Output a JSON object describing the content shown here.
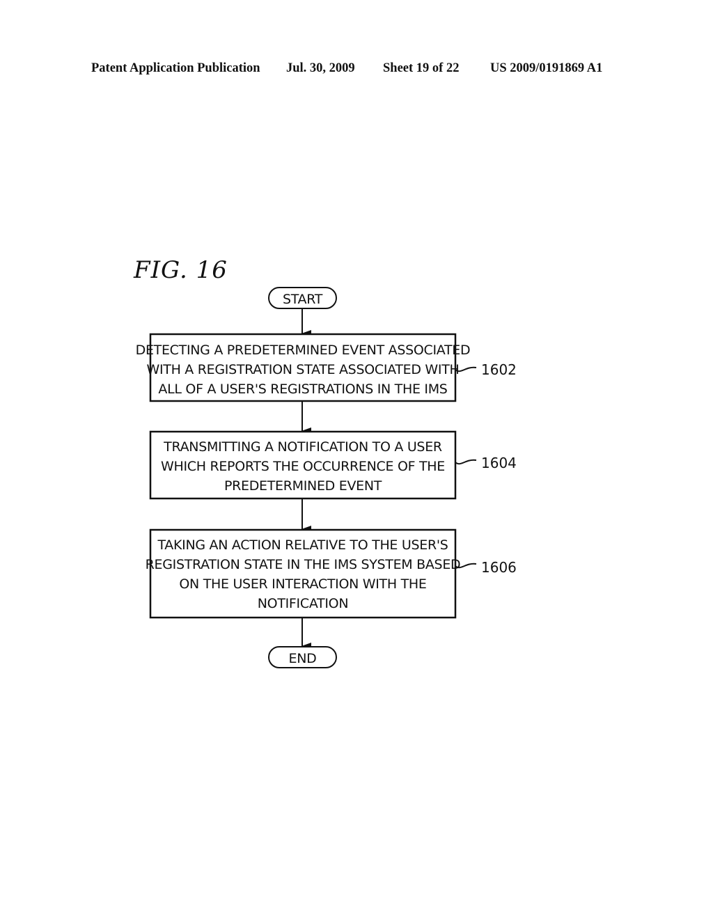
{
  "header": {
    "publication": "Patent Application Publication",
    "date": "Jul. 30, 2009",
    "sheet": "Sheet 19 of 22",
    "number": "US 2009/0191869 A1"
  },
  "figure": {
    "title": "FIG. 16",
    "start_label": "START",
    "end_label": "END",
    "steps": [
      {
        "ref": "1602",
        "lines": [
          "DETECTING A PREDETERMINED EVENT ASSOCIATED",
          "WITH A REGISTRATION STATE ASSOCIATED WITH",
          "ALL OF A USER'S REGISTRATIONS IN THE IMS"
        ]
      },
      {
        "ref": "1604",
        "lines": [
          "TRANSMITTING A NOTIFICATION TO A USER",
          "WHICH REPORTS THE OCCURRENCE OF THE",
          "PREDETERMINED EVENT"
        ]
      },
      {
        "ref": "1606",
        "lines": [
          "TAKING AN ACTION RELATIVE TO THE USER'S",
          "REGISTRATION STATE IN THE IMS SYSTEM BASED",
          "ON THE USER INTERACTION WITH THE",
          "NOTIFICATION"
        ]
      }
    ]
  }
}
